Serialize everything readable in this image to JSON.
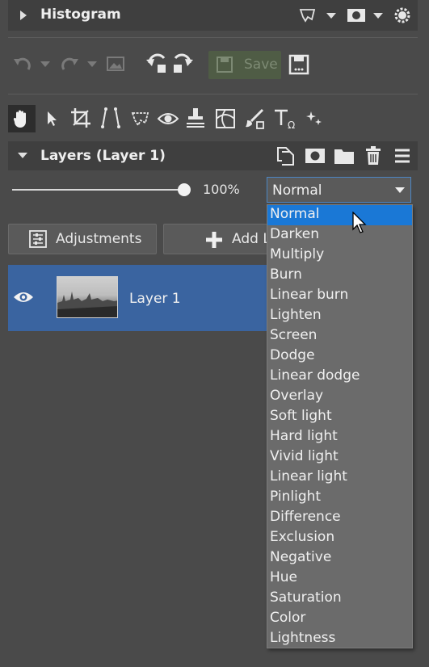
{
  "histogram": {
    "title": "Histogram"
  },
  "toolbar": {
    "save_label": "Save"
  },
  "layers": {
    "title": "Layers (Layer 1)",
    "opacity": "100%",
    "blend_mode": "Normal",
    "adjustments_label": "Adjustments",
    "add_layer_label": "Add L",
    "layer_name": "Layer 1"
  },
  "blend_modes": [
    "Normal",
    "Darken",
    "Multiply",
    "Burn",
    "Linear burn",
    "Lighten",
    "Screen",
    "Dodge",
    "Linear dodge",
    "Overlay",
    "Soft light",
    "Hard light",
    "Vivid light",
    "Linear light",
    "Pinlight",
    "Difference",
    "Exclusion",
    "Negative",
    "Hue",
    "Saturation",
    "Color",
    "Lightness"
  ],
  "selected_blend_index": 0,
  "colors": {
    "accent": "#1a78d6",
    "selected_layer": "#3a64a0"
  }
}
